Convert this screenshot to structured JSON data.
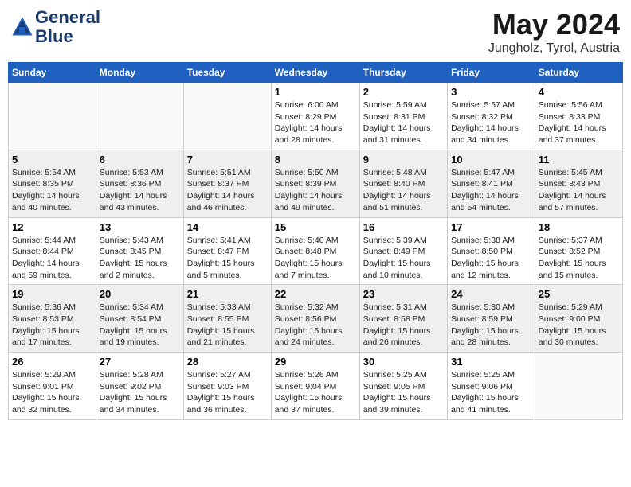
{
  "header": {
    "logo_line1": "General",
    "logo_line2": "Blue",
    "month": "May 2024",
    "location": "Jungholz, Tyrol, Austria"
  },
  "weekdays": [
    "Sunday",
    "Monday",
    "Tuesday",
    "Wednesday",
    "Thursday",
    "Friday",
    "Saturday"
  ],
  "weeks": [
    [
      {
        "day": "",
        "info": ""
      },
      {
        "day": "",
        "info": ""
      },
      {
        "day": "",
        "info": ""
      },
      {
        "day": "1",
        "info": "Sunrise: 6:00 AM\nSunset: 8:29 PM\nDaylight: 14 hours\nand 28 minutes."
      },
      {
        "day": "2",
        "info": "Sunrise: 5:59 AM\nSunset: 8:31 PM\nDaylight: 14 hours\nand 31 minutes."
      },
      {
        "day": "3",
        "info": "Sunrise: 5:57 AM\nSunset: 8:32 PM\nDaylight: 14 hours\nand 34 minutes."
      },
      {
        "day": "4",
        "info": "Sunrise: 5:56 AM\nSunset: 8:33 PM\nDaylight: 14 hours\nand 37 minutes."
      }
    ],
    [
      {
        "day": "5",
        "info": "Sunrise: 5:54 AM\nSunset: 8:35 PM\nDaylight: 14 hours\nand 40 minutes."
      },
      {
        "day": "6",
        "info": "Sunrise: 5:53 AM\nSunset: 8:36 PM\nDaylight: 14 hours\nand 43 minutes."
      },
      {
        "day": "7",
        "info": "Sunrise: 5:51 AM\nSunset: 8:37 PM\nDaylight: 14 hours\nand 46 minutes."
      },
      {
        "day": "8",
        "info": "Sunrise: 5:50 AM\nSunset: 8:39 PM\nDaylight: 14 hours\nand 49 minutes."
      },
      {
        "day": "9",
        "info": "Sunrise: 5:48 AM\nSunset: 8:40 PM\nDaylight: 14 hours\nand 51 minutes."
      },
      {
        "day": "10",
        "info": "Sunrise: 5:47 AM\nSunset: 8:41 PM\nDaylight: 14 hours\nand 54 minutes."
      },
      {
        "day": "11",
        "info": "Sunrise: 5:45 AM\nSunset: 8:43 PM\nDaylight: 14 hours\nand 57 minutes."
      }
    ],
    [
      {
        "day": "12",
        "info": "Sunrise: 5:44 AM\nSunset: 8:44 PM\nDaylight: 14 hours\nand 59 minutes."
      },
      {
        "day": "13",
        "info": "Sunrise: 5:43 AM\nSunset: 8:45 PM\nDaylight: 15 hours\nand 2 minutes."
      },
      {
        "day": "14",
        "info": "Sunrise: 5:41 AM\nSunset: 8:47 PM\nDaylight: 15 hours\nand 5 minutes."
      },
      {
        "day": "15",
        "info": "Sunrise: 5:40 AM\nSunset: 8:48 PM\nDaylight: 15 hours\nand 7 minutes."
      },
      {
        "day": "16",
        "info": "Sunrise: 5:39 AM\nSunset: 8:49 PM\nDaylight: 15 hours\nand 10 minutes."
      },
      {
        "day": "17",
        "info": "Sunrise: 5:38 AM\nSunset: 8:50 PM\nDaylight: 15 hours\nand 12 minutes."
      },
      {
        "day": "18",
        "info": "Sunrise: 5:37 AM\nSunset: 8:52 PM\nDaylight: 15 hours\nand 15 minutes."
      }
    ],
    [
      {
        "day": "19",
        "info": "Sunrise: 5:36 AM\nSunset: 8:53 PM\nDaylight: 15 hours\nand 17 minutes."
      },
      {
        "day": "20",
        "info": "Sunrise: 5:34 AM\nSunset: 8:54 PM\nDaylight: 15 hours\nand 19 minutes."
      },
      {
        "day": "21",
        "info": "Sunrise: 5:33 AM\nSunset: 8:55 PM\nDaylight: 15 hours\nand 21 minutes."
      },
      {
        "day": "22",
        "info": "Sunrise: 5:32 AM\nSunset: 8:56 PM\nDaylight: 15 hours\nand 24 minutes."
      },
      {
        "day": "23",
        "info": "Sunrise: 5:31 AM\nSunset: 8:58 PM\nDaylight: 15 hours\nand 26 minutes."
      },
      {
        "day": "24",
        "info": "Sunrise: 5:30 AM\nSunset: 8:59 PM\nDaylight: 15 hours\nand 28 minutes."
      },
      {
        "day": "25",
        "info": "Sunrise: 5:29 AM\nSunset: 9:00 PM\nDaylight: 15 hours\nand 30 minutes."
      }
    ],
    [
      {
        "day": "26",
        "info": "Sunrise: 5:29 AM\nSunset: 9:01 PM\nDaylight: 15 hours\nand 32 minutes."
      },
      {
        "day": "27",
        "info": "Sunrise: 5:28 AM\nSunset: 9:02 PM\nDaylight: 15 hours\nand 34 minutes."
      },
      {
        "day": "28",
        "info": "Sunrise: 5:27 AM\nSunset: 9:03 PM\nDaylight: 15 hours\nand 36 minutes."
      },
      {
        "day": "29",
        "info": "Sunrise: 5:26 AM\nSunset: 9:04 PM\nDaylight: 15 hours\nand 37 minutes."
      },
      {
        "day": "30",
        "info": "Sunrise: 5:25 AM\nSunset: 9:05 PM\nDaylight: 15 hours\nand 39 minutes."
      },
      {
        "day": "31",
        "info": "Sunrise: 5:25 AM\nSunset: 9:06 PM\nDaylight: 15 hours\nand 41 minutes."
      },
      {
        "day": "",
        "info": ""
      }
    ]
  ]
}
